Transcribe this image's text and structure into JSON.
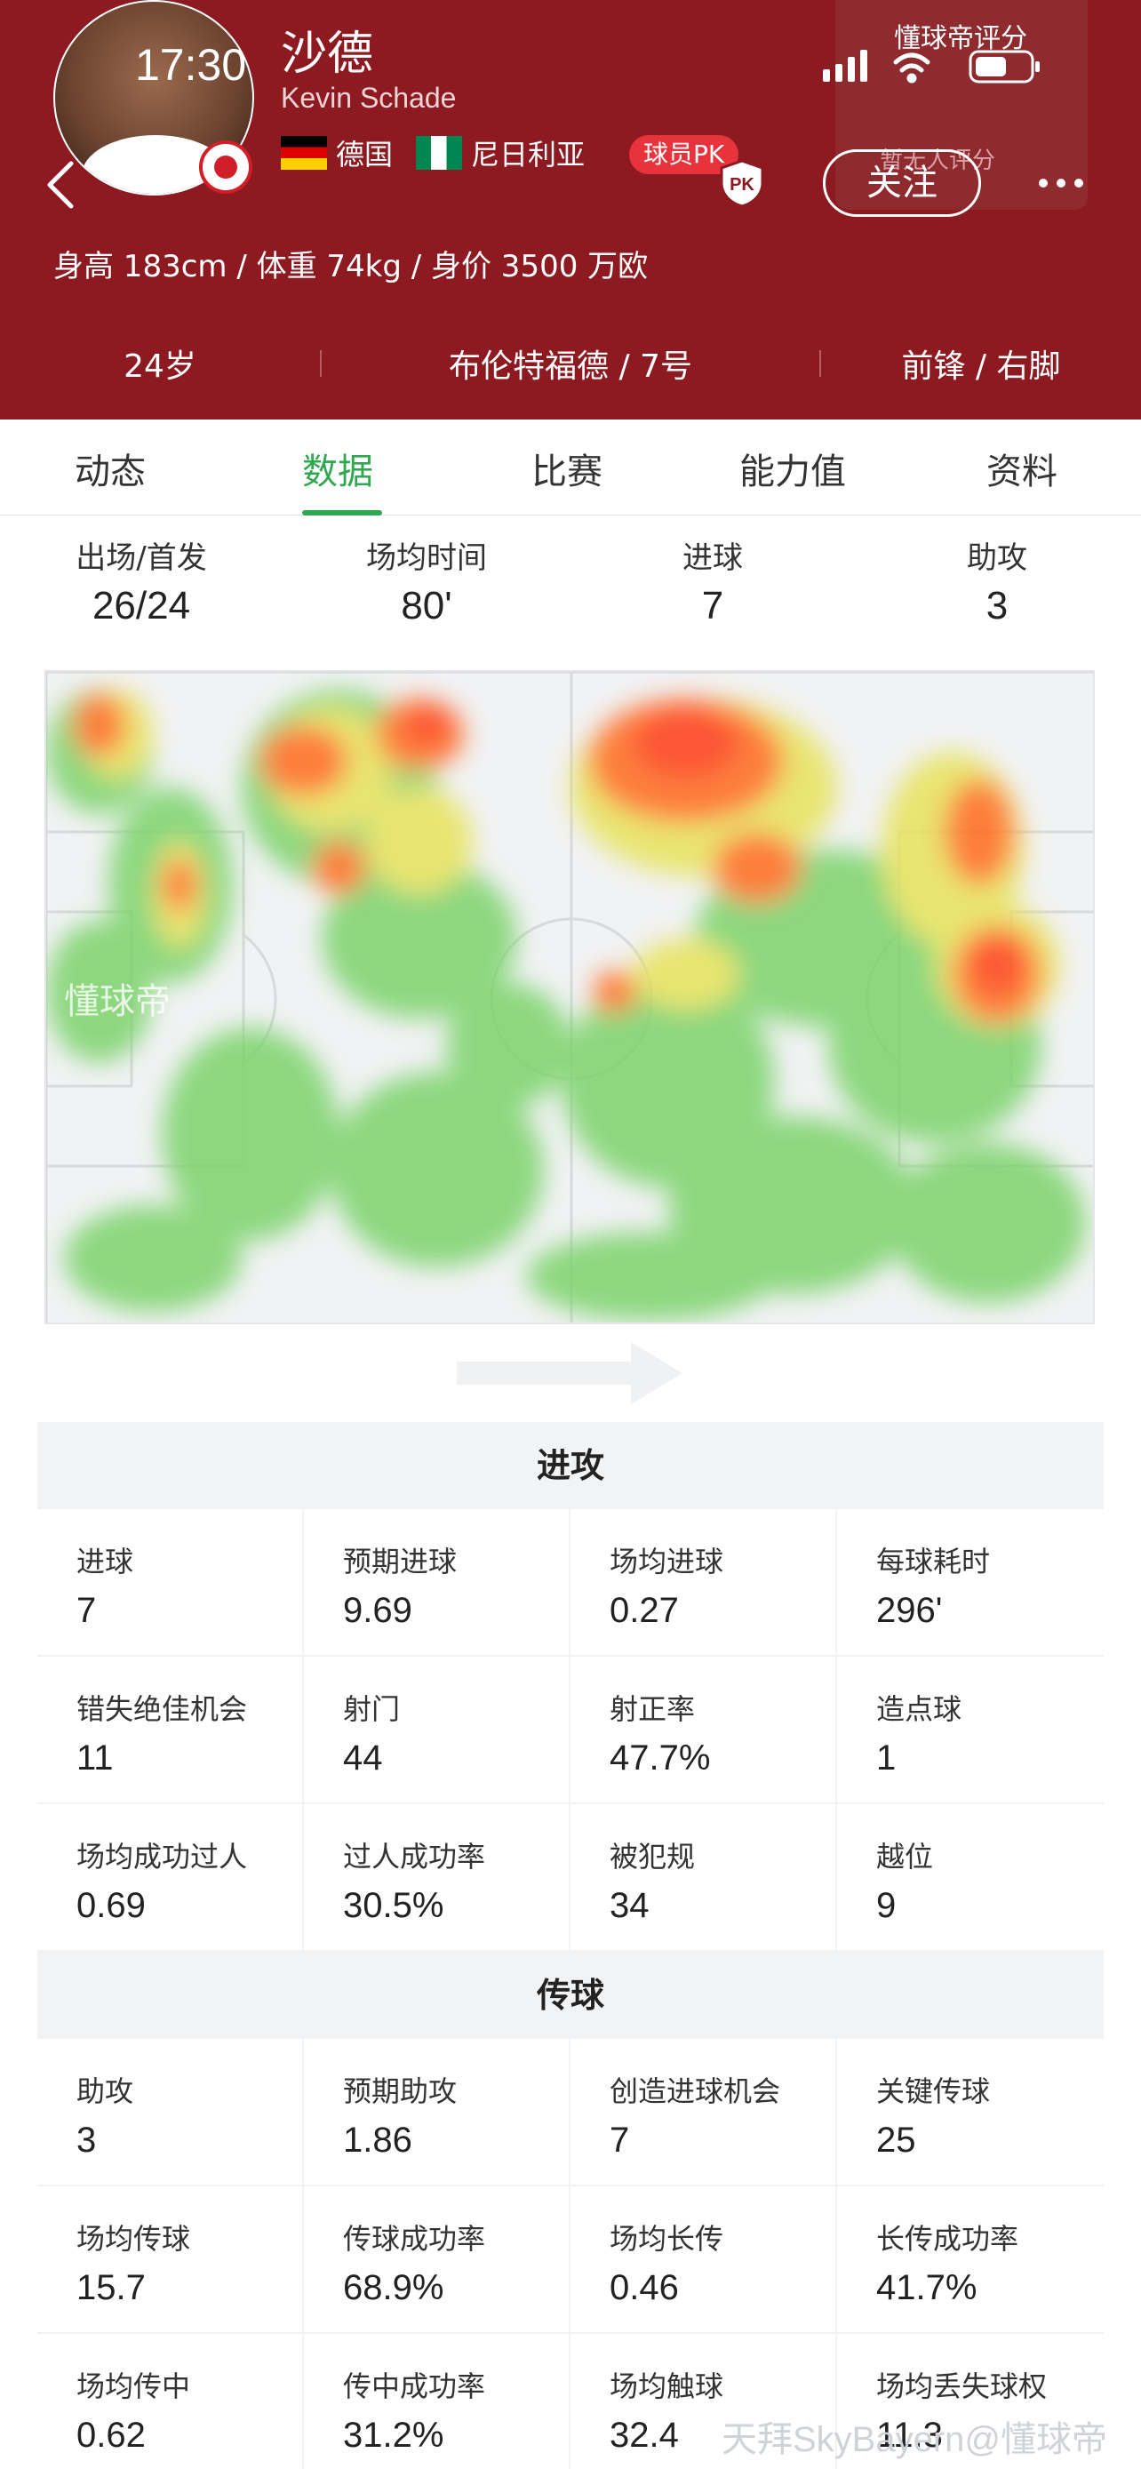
{
  "status_bar": {
    "time": "17:30"
  },
  "player": {
    "name_cn": "沙德",
    "name_en": "Kevin Schade",
    "nationality_1": "德国",
    "nationality_2": "尼日利亚",
    "pk_label": "球员PK",
    "body_info": "身高 183cm / 体重 74kg / 身价 3500 万欧",
    "age": "24岁",
    "club_number": "布伦特福德 / 7号",
    "position_foot": "前锋 / 右脚"
  },
  "rating_popup": {
    "title": "懂球帝评分",
    "subtitle": "暂无人评分"
  },
  "header_actions": {
    "follow_label": "关注"
  },
  "tabs": [
    {
      "label": "动态"
    },
    {
      "label": "数据"
    },
    {
      "label": "比赛"
    },
    {
      "label": "能力值"
    },
    {
      "label": "资料"
    }
  ],
  "summary": [
    {
      "label": "出场/首发",
      "value": "26/24"
    },
    {
      "label": "场均时间",
      "value": "80'"
    },
    {
      "label": "进球",
      "value": "7"
    },
    {
      "label": "助攻",
      "value": "3"
    }
  ],
  "heatmap": {
    "watermark": "懂球帝"
  },
  "sections": [
    {
      "title": "进攻",
      "rows": [
        [
          {
            "label": "进球",
            "value": "7"
          },
          {
            "label": "预期进球",
            "value": "9.69"
          },
          {
            "label": "场均进球",
            "value": "0.27"
          },
          {
            "label": "每球耗时",
            "value": "296'"
          }
        ],
        [
          {
            "label": "错失绝佳机会",
            "value": "11"
          },
          {
            "label": "射门",
            "value": "44"
          },
          {
            "label": "射正率",
            "value": "47.7%"
          },
          {
            "label": "造点球",
            "value": "1"
          }
        ],
        [
          {
            "label": "场均成功过人",
            "value": "0.69"
          },
          {
            "label": "过人成功率",
            "value": "30.5%"
          },
          {
            "label": "被犯规",
            "value": "34"
          },
          {
            "label": "越位",
            "value": "9"
          }
        ]
      ]
    },
    {
      "title": "传球",
      "rows": [
        [
          {
            "label": "助攻",
            "value": "3"
          },
          {
            "label": "预期助攻",
            "value": "1.86"
          },
          {
            "label": "创造进球机会",
            "value": "7"
          },
          {
            "label": "关键传球",
            "value": "25"
          }
        ],
        [
          {
            "label": "场均传球",
            "value": "15.7"
          },
          {
            "label": "传球成功率",
            "value": "68.9%"
          },
          {
            "label": "场均长传",
            "value": "0.46"
          },
          {
            "label": "长传成功率",
            "value": "41.7%"
          }
        ],
        [
          {
            "label": "场均传中",
            "value": "0.62"
          },
          {
            "label": "传中成功率",
            "value": "31.2%"
          },
          {
            "label": "场均触球",
            "value": "32.4"
          },
          {
            "label": "场均丢失球权",
            "value": "11.3"
          }
        ]
      ]
    }
  ],
  "watermark": "天拜SkyBayern@懂球帝",
  "colors": {
    "header_bg": "#8d1a21",
    "accent_green": "#2fa84f",
    "pk_red": "#e8333c"
  }
}
